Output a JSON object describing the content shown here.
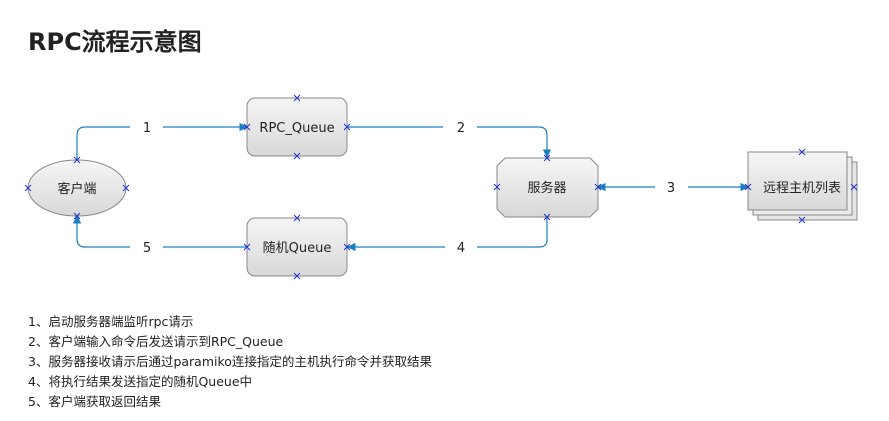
{
  "title": "RPC流程示意图",
  "nodes": {
    "client": "客户端",
    "rpc_queue": "RPC_Queue",
    "server": "服务器",
    "random_queue": "随机Queue",
    "remote_hosts": "远程主机列表"
  },
  "edges": {
    "e1": "1",
    "e2": "2",
    "e3": "3",
    "e4": "4",
    "e5": "5"
  },
  "colors": {
    "connector": "#1a7fc1",
    "port_marker": "#2233cc",
    "node_border": "#888888",
    "node_fill_top": "#f4f4f4",
    "node_fill_bottom": "#d9d9d9"
  },
  "steps": [
    "1、启动服务器端监听rpc请示",
    "2、客户端输入命令后发送请示到RPC_Queue",
    "3、服务器接收请示后通过paramiko连接指定的主机执行命令并获取结果",
    "4、将执行结果发送指定的随机Queue中",
    "5、客户端获取返回结果"
  ]
}
